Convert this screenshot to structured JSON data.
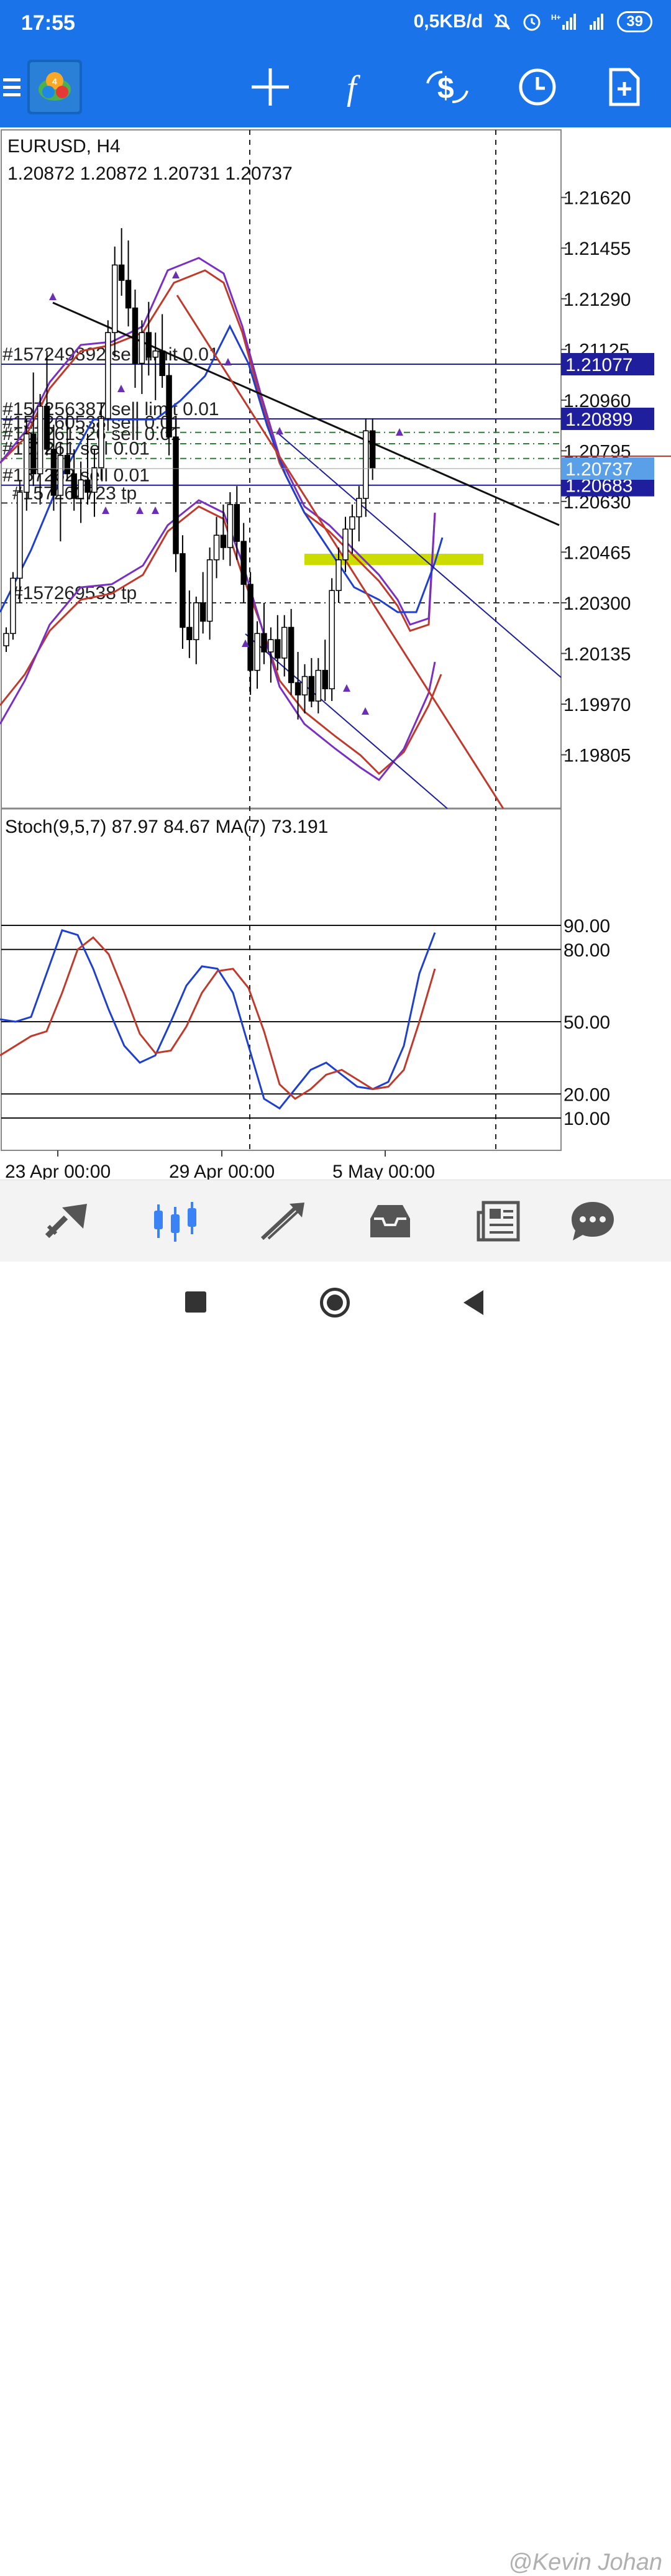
{
  "status_bar": {
    "time": "17:55",
    "network_speed": "0,5KB/d",
    "battery_level": "39",
    "icons": [
      "mute-bell-icon",
      "alarm-icon",
      "signal-hplus-icon",
      "signal-icon",
      "battery-icon"
    ]
  },
  "toolbar": {
    "icons": [
      "menu-icon",
      "metatrader-logo",
      "crosshair-icon",
      "function-icon",
      "trade-icon",
      "clock-icon",
      "new-document-icon"
    ]
  },
  "chart": {
    "symbol_label": "EURUSD, H4",
    "ohlc_label": "1.20872 1.20872 1.20731 1.20737",
    "price_ticks": [
      "1.21620",
      "1.21455",
      "1.21290",
      "1.21125",
      "1.20960",
      "1.20795",
      "1.20630",
      "1.20465",
      "1.20300",
      "1.20135",
      "1.19970",
      "1.19805"
    ],
    "price_range": [
      1.1963,
      1.2184
    ],
    "order_lines": [
      {
        "label": "#157249892 sell limit 0.01",
        "price": 1.21077,
        "tag": "1.21077",
        "color": "#1f1f9e"
      },
      {
        "label": "#157256387 sell limit 0.01",
        "price": 1.20899,
        "tag": "1.20899",
        "color": "#1f1f9e"
      },
      {
        "label": "#157260538 sell 0.01",
        "price": 1.20855,
        "tag": "",
        "color": "#2e7d32"
      },
      {
        "label": "#157261326 sell 0.01",
        "price": 1.20818,
        "tag": "",
        "color": "#2e7d32"
      },
      {
        "label": "#157261 sell 0.01",
        "price": 1.2077,
        "tag": "",
        "color": "#2e7d32"
      },
      {
        "label": "#157262 sell 0.01",
        "price": 1.20683,
        "tag": "1.20683",
        "color": "#1f1f9e"
      },
      {
        "label": "#157262723 tp",
        "price": 1.20625,
        "tag": "",
        "color": "#333333"
      },
      {
        "label": "#157269538 tp",
        "price": 1.203,
        "tag": "",
        "color": "#333333"
      }
    ],
    "current_price": {
      "value": 1.20737,
      "tag": "1.20737"
    },
    "time_labels": [
      "23 Apr 00:00",
      "29 Apr 00:00",
      "5 May 00:00"
    ]
  },
  "stochastic": {
    "label": "Stoch(9,5,7) 87.97 84.67 MA(7) 73.191",
    "levels": [
      "90.00",
      "80.00",
      "50.00",
      "20.00",
      "10.00"
    ],
    "main_values": [
      51,
      50,
      52,
      70,
      88,
      86,
      72,
      55,
      40,
      33,
      36,
      50,
      65,
      73,
      72,
      62,
      40,
      18,
      14,
      22,
      30,
      33,
      28,
      23,
      22,
      25,
      40,
      70,
      87
    ],
    "signal_values": [
      36,
      40,
      44,
      46,
      62,
      80,
      85,
      78,
      62,
      45,
      37,
      38,
      48,
      62,
      71,
      72,
      64,
      46,
      24,
      18,
      22,
      28,
      30,
      26,
      22,
      23,
      30,
      50,
      72
    ]
  },
  "bottom_nav": {
    "items": [
      "quotes-icon",
      "chart-icon",
      "trade-icon",
      "history-icon",
      "news-icon",
      "chat-icon"
    ],
    "active": "chart-icon"
  },
  "system_nav": {
    "watermark": "@Kevin Johan"
  },
  "colors": {
    "brand_blue": "#1a73e8",
    "bull_candle": "#ffffff",
    "bear_candle": "#000000",
    "red_band": "#c0392b",
    "purple_band": "#7a2fc4",
    "blue_band": "#1e3fd0",
    "highlight_zone": "#cddc00"
  }
}
